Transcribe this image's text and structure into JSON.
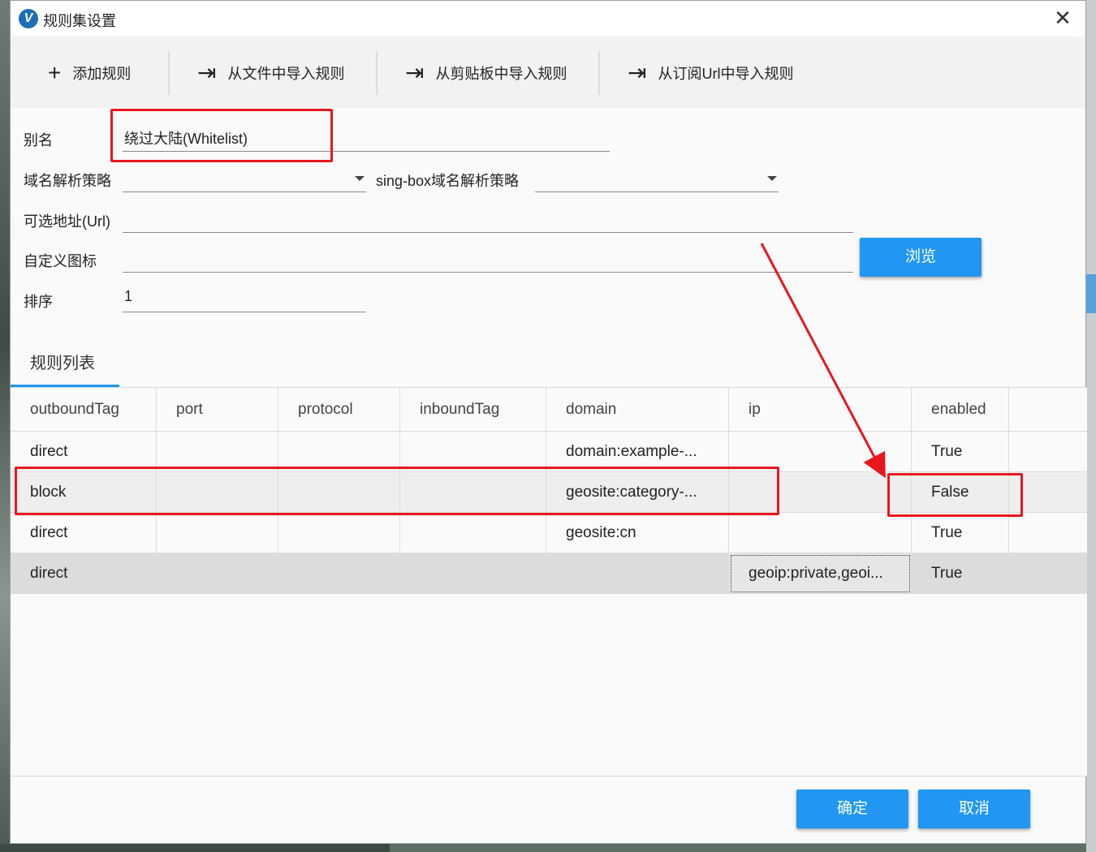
{
  "window": {
    "title": "规则集设置",
    "app_icon_letter": "V",
    "close_glyph": "✕"
  },
  "toolbar": {
    "add_rule": {
      "icon": "+",
      "label": "添加规则"
    },
    "import_file": {
      "icon": "⇥",
      "label": "从文件中导入规则"
    },
    "import_clipboard": {
      "icon": "⇥",
      "label": "从剪贴板中导入规则"
    },
    "import_url": {
      "icon": "⇥",
      "label": "从订阅Url中导入规则"
    }
  },
  "form": {
    "alias_label": "别名",
    "alias_value": "绕过大陆(Whitelist)",
    "dns_strategy_label": "域名解析策略",
    "dns_strategy_value": "",
    "singbox_dns_label": "sing-box域名解析策略",
    "singbox_dns_value": "",
    "url_label": "可选地址(Url)",
    "url_value": "",
    "icon_label": "自定义图标",
    "icon_value": "",
    "browse_label": "浏览",
    "sort_label": "排序",
    "sort_value": "1"
  },
  "tabs": {
    "rules_list": "规则列表"
  },
  "table": {
    "columns": [
      "outboundTag",
      "port",
      "protocol",
      "inboundTag",
      "domain",
      "ip",
      "enabled"
    ],
    "rows": [
      [
        "direct",
        "",
        "",
        "",
        "domain:example-...",
        "",
        "True"
      ],
      [
        "block",
        "",
        "",
        "",
        "geosite:category-...",
        "",
        "False"
      ],
      [
        "direct",
        "",
        "",
        "",
        "geosite:cn",
        "",
        "True"
      ],
      [
        "direct",
        "",
        "",
        "",
        "",
        "geoip:private,geoi...",
        "True"
      ]
    ]
  },
  "footer": {
    "ok_label": "确定",
    "cancel_label": "取消"
  },
  "colors": {
    "accent": "#2196f3",
    "highlight": "#e8171e"
  }
}
